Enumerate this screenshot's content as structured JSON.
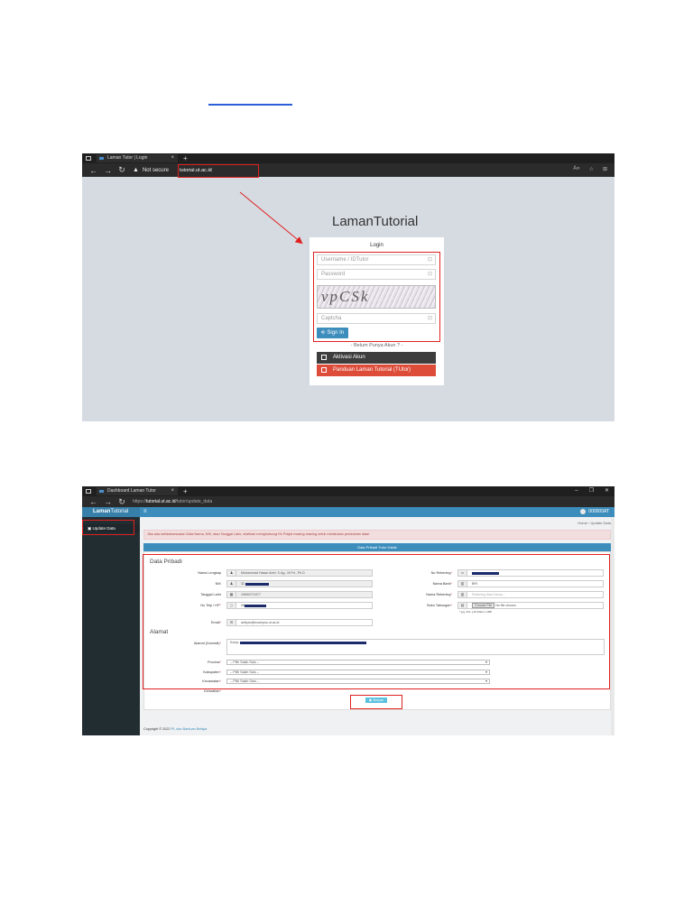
{
  "login_shot": {
    "tab_title": "Laman Tutor | Login",
    "not_secure": "Not secure",
    "url": "tutorial.ut.ac.id",
    "brand_bold": "Laman",
    "brand_rest": "Tutorial",
    "login_title": "Login",
    "username_placeholder": "Username / IDTutor",
    "password_placeholder": "Password",
    "captcha_text": "vpCSk",
    "captcha_placeholder": "Captcha",
    "signin_label": "Sign In",
    "no_account": "- Belum Punya Akun ? -",
    "aktivasi_label": "Aktivasi Akun",
    "panduan_label": "Panduan Laman Tutorial (TUtor)"
  },
  "dashboard_shot": {
    "tab_title": "Dashboard Laman Tutor",
    "url_prefix": "https://",
    "url_host": "tutorial.ut.ac.id",
    "url_path": "/tutor/update_data",
    "logo_bold": "Laman",
    "logo_rest": "Tutorial",
    "menu_icon": "≡",
    "user_id": "000000AT",
    "sidebar_item": "Update Data",
    "breadcrumb": "Home › Update Data",
    "alert": "Jika ada ketidaksesuaian Data Nama, NIK, atau Tanggal Lahir, silahkan menghubungi Kk Pokjal masing-masing untuk melakukan perubahan data!",
    "panel_title": "Data Pribadi Tutor Kalde",
    "section_pribadi": "Data Pribadi",
    "section_alamat": "Alamat",
    "labels": {
      "nama": "Nama Lengkap",
      "nik": "NIK",
      "tgl": "Tanggal Lahir",
      "hp": "No Telp / HP",
      "email": "Email",
      "rekening": "No Rekening",
      "bank": "Nama Bank",
      "nama_rek": "Nama Rekening",
      "buku": "Buku Tabungan",
      "alamat": "Alamat (Domisili)",
      "provinsi": "Provinsi",
      "kabupaten": "Kabupaten",
      "kecamatan": "Kecamatan",
      "kelurahan": "Kelurahan"
    },
    "values": {
      "nama": "Muhammad Hasan Anfri, S.Ag., M.Pd., Ph.D",
      "nik": "32",
      "tgl": "1969/07/1977",
      "hp": "08",
      "email": "anfiyan@ecampus.ut.ac.id",
      "bank": "BRI",
      "nama_rek_placeholder": "Rekening Atas Nama...",
      "file_button": "Choose File",
      "file_none": "No file chosen",
      "file_hint": "*.jpg, File .pdf (Maks 1 MB)",
      "alamat": "Komp.",
      "select_placeholder": "-- Pilih Salah Satu --"
    },
    "submit_label": "Simpan",
    "footer_text": "Copyright © 2022",
    "footer_link": "PL dan Bantuan Belajar"
  },
  "colors": {
    "accent": "#3c8dbc",
    "annotation_red": "#e02020",
    "danger": "#dd4b39"
  }
}
